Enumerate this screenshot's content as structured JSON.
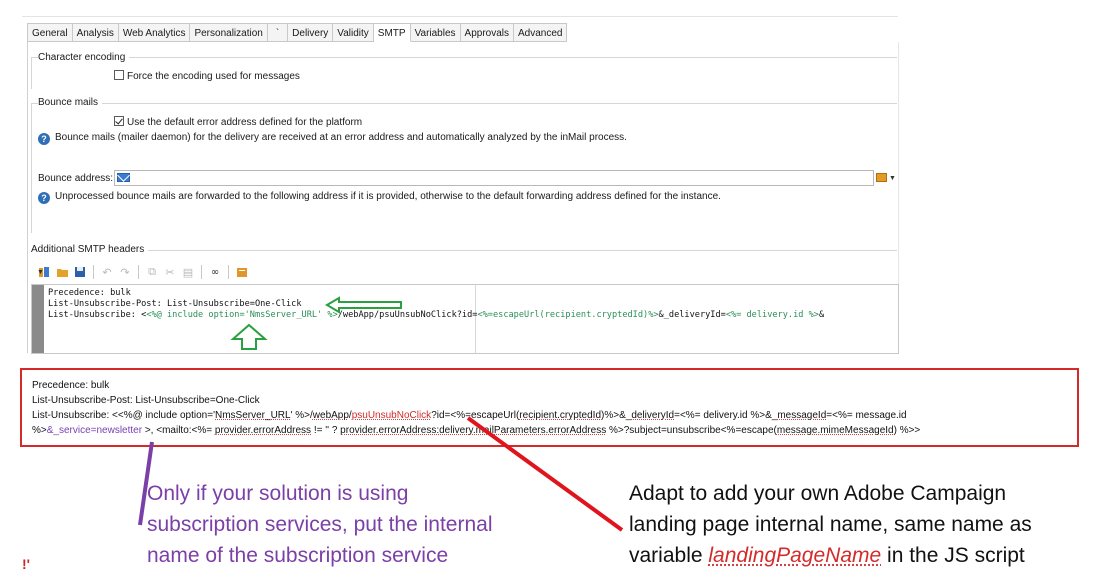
{
  "tabs": [
    "General",
    "Analysis",
    "Web Analytics",
    "Personalization",
    "`",
    "Delivery",
    "Validity",
    "SMTP",
    "Variables",
    "Approvals",
    "Advanced"
  ],
  "active_tab": "SMTP",
  "character_encoding": {
    "title": "Character encoding",
    "force_label": "Force the encoding used for messages",
    "force_checked": false
  },
  "bounce_mails": {
    "title": "Bounce mails",
    "default_label": "Use the default error address defined for the platform",
    "default_checked": true,
    "info1": "Bounce mails (mailer daemon) for the delivery are received at an error address and automatically analyzed by the inMail process.",
    "address_label": "Bounce address:",
    "address_value": "",
    "info2": "Unprocessed bounce mails are forwarded to the following address if it is provided, otherwise to the default forwarding address defined for the instance."
  },
  "smtp_headers": {
    "title": "Additional SMTP headers",
    "toolbar_icons": [
      "insert-icon",
      "open-icon",
      "save-icon",
      "undo-icon",
      "redo-icon",
      "copy-icon",
      "cut-icon",
      "paste-icon",
      "find-icon",
      "address-book-icon"
    ],
    "code_lines": {
      "l1": "Precedence: bulk",
      "l2": "List-Unsubscribe-Post: List-Unsubscribe=One-Click",
      "l3a": "List-Unsubscribe: <",
      "l3b": "<%@ include option='NmsServer_URL' %>",
      "l3c": "/webApp/psuUnsubNoClick?id=",
      "l3d": "<%=escapeUrl(recipient.cryptedId)%>",
      "l3e": "&_deliveryId=",
      "l3f": "<%= delivery.id %>",
      "l3g": "&"
    }
  },
  "red_box": {
    "line1": "Precedence: bulk",
    "line2": "List-Unsubscribe-Post: List-Unsubscribe=One-Click",
    "line3a": "List-Unsubscribe: <<%@ include option='",
    "line3b": "NmsServer_URL",
    "line3c": "' %>/",
    "line3d": "webApp",
    "line3e": "/",
    "line3f": "psuUnsubNoClick",
    "line3g": "?id=<%=escapeUrl(",
    "line3h": "recipient.cryptedId",
    "line3i": ")%>&_",
    "line3j": "deliveryId",
    "line3k": "=<%= delivery.id %>&_",
    "line3l": "messageId",
    "line3m": "=<%= message.id",
    "line4a": "%>",
    "line4b": "&_service=newsletter",
    "line4c": " >, <mailto:<%= ",
    "line4d": "provider.errorAddress",
    "line4e": " != '' ? ",
    "line4f": "provider.errorAddress:delivery.mailParameters.errorAddress",
    "line4g": " %>?subject=unsubscribe<%=escape(",
    "line4h": "message.mimeMessageId",
    "line4i": ") %>>"
  },
  "notes": {
    "left1": "Only if your solution is using",
    "left2": "subscription services, put the internal",
    "left3": "name of the subscription service",
    "right1": "Adapt to add your own Adobe Campaign",
    "right2": "landing page internal name, same name as",
    "right3a": "variable ",
    "right3b": "landingPageName",
    "right3c": " in the JS script"
  },
  "colors": {
    "red_annotation": "#d42a2a",
    "purple_annotation": "#7b3fa8",
    "green_arrow": "#2aa040",
    "info_icon": "#2f6fb5"
  }
}
